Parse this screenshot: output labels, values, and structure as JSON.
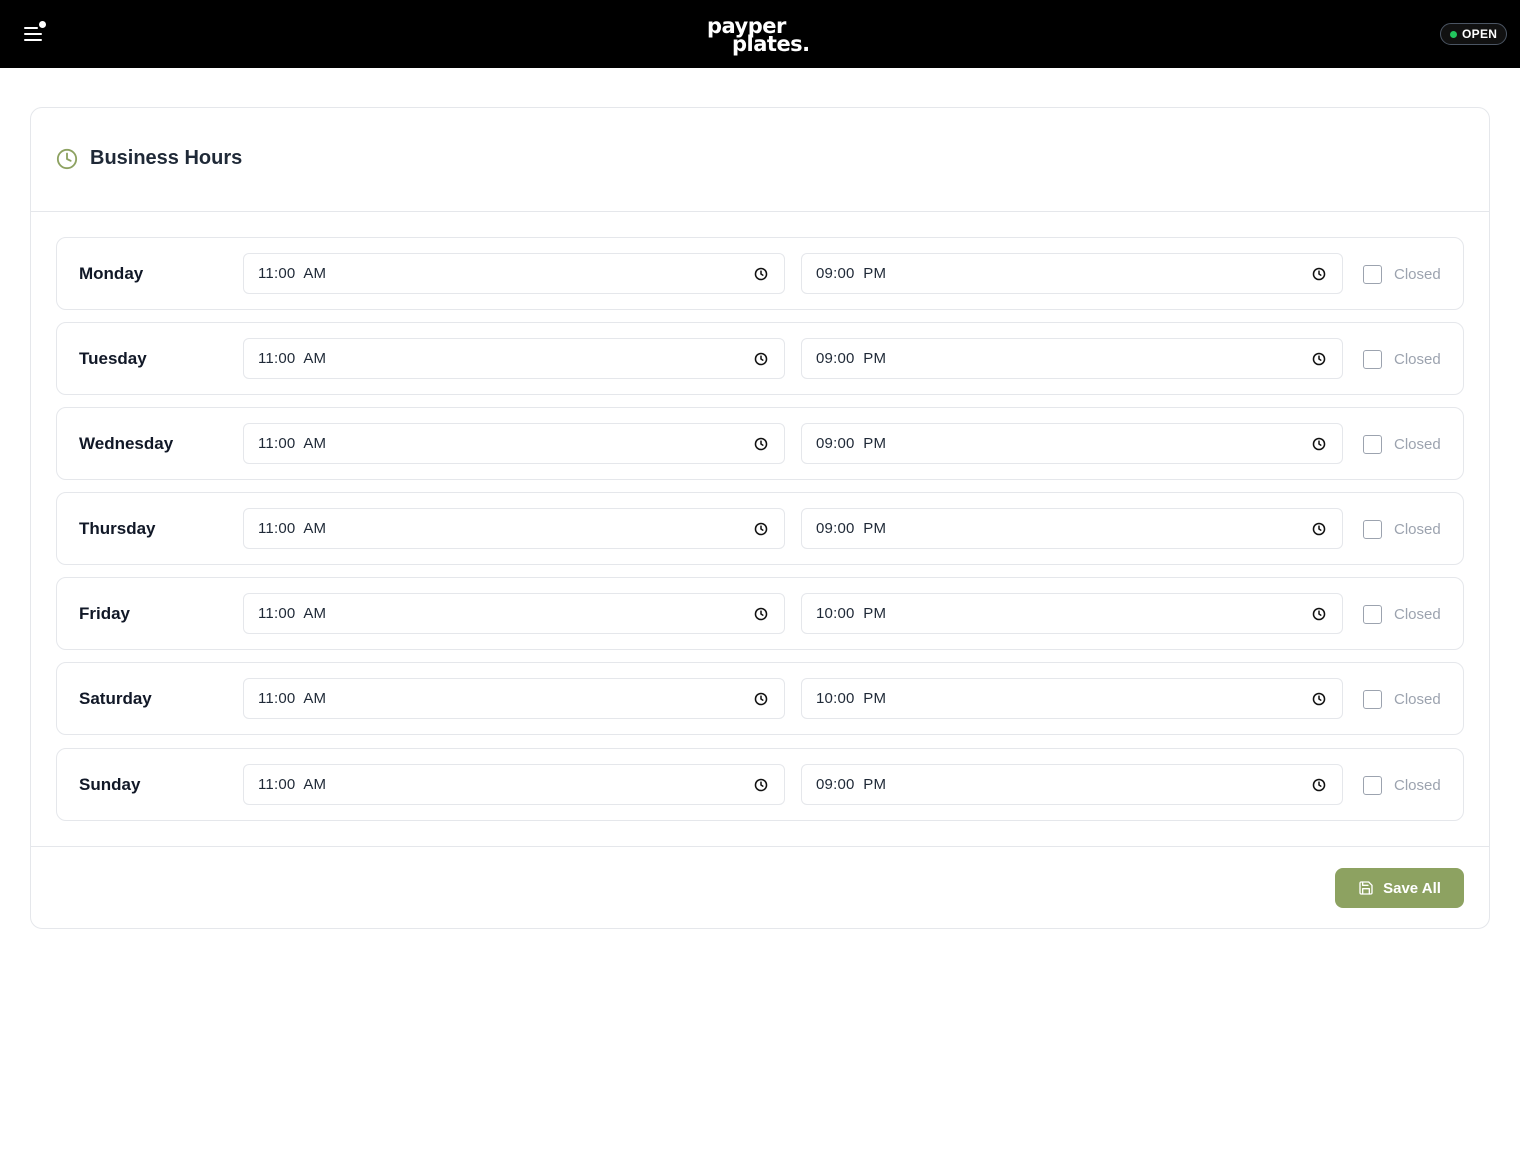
{
  "header": {
    "brand_line1": "payper",
    "brand_line2": "plates.",
    "status_label": "OPEN",
    "status_color": "#22c55e",
    "menu_icon": "menu-icon"
  },
  "card": {
    "title": "Business Hours",
    "title_icon": "clock-icon",
    "accent_color": "#8da261"
  },
  "days": [
    {
      "name": "Monday",
      "open": "11:00  AM",
      "close": "09:00  PM",
      "closed_label": "Closed",
      "closed": false
    },
    {
      "name": "Tuesday",
      "open": "11:00  AM",
      "close": "09:00  PM",
      "closed_label": "Closed",
      "closed": false
    },
    {
      "name": "Wednesday",
      "open": "11:00  AM",
      "close": "09:00  PM",
      "closed_label": "Closed",
      "closed": false
    },
    {
      "name": "Thursday",
      "open": "11:00  AM",
      "close": "09:00  PM",
      "closed_label": "Closed",
      "closed": false
    },
    {
      "name": "Friday",
      "open": "11:00  AM",
      "close": "10:00  PM",
      "closed_label": "Closed",
      "closed": false
    },
    {
      "name": "Saturday",
      "open": "11:00  AM",
      "close": "10:00  PM",
      "closed_label": "Closed",
      "closed": false
    },
    {
      "name": "Sunday",
      "open": "11:00  AM",
      "close": "09:00  PM",
      "closed_label": "Closed",
      "closed": false
    }
  ],
  "footer": {
    "save_label": "Save All",
    "save_icon": "save-icon"
  }
}
